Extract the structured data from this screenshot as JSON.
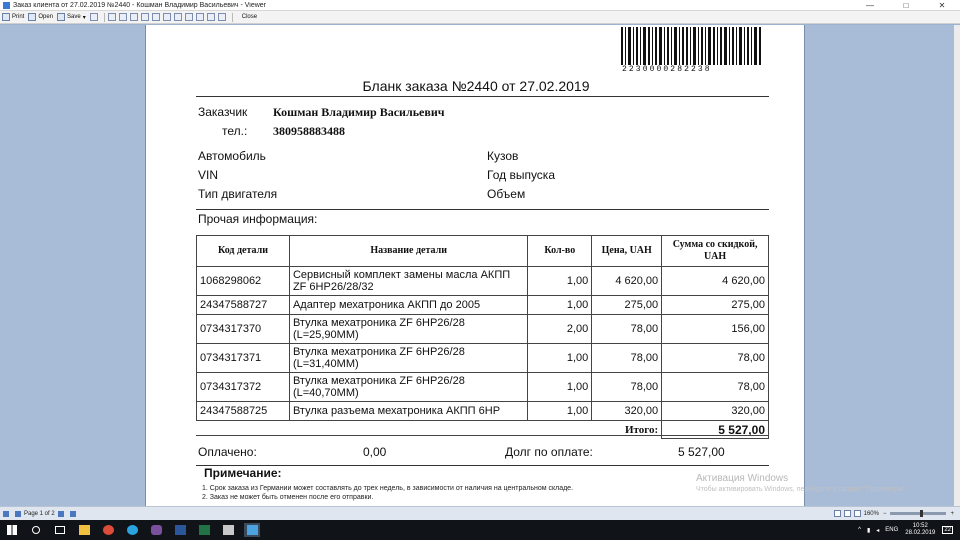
{
  "window": {
    "title": "Заказ клиента от 27.02.2019 №2440 - Кошман Владимир Васильевич - Viewer",
    "minimize": "—",
    "maximize": "□",
    "close": "✕"
  },
  "toolbar": {
    "print": "Print",
    "open": "Open",
    "save": "Save",
    "close": "Close"
  },
  "document": {
    "barcode_number": "2230000282238",
    "title": "Бланк заказа №2440 от 27.02.2019",
    "customer_label": "Заказчик",
    "customer_name": "Кошман Владимир Васильевич",
    "phone_label": "тел.:",
    "phone": "380958883488",
    "car_label": "Автомобиль",
    "vin_label": "VIN",
    "engine_label": "Тип двигателя",
    "body_label": "Кузов",
    "year_label": "Год выпуска",
    "volume_label": "Объем",
    "other_info_label": "Прочая информация:",
    "table": {
      "headers": [
        "Код детали",
        "Название детали",
        "Кол-во",
        "Цена, UAH",
        "Сумма со скидкой, UAH"
      ],
      "rows": [
        {
          "code": "1068298062",
          "name": "Сервисный комплект замены масла АКПП ZF 6HP26/28/32",
          "qty": "1,00",
          "price": "4 620,00",
          "sum": "4 620,00"
        },
        {
          "code": "24347588727",
          "name": "Адаптер мехатроника АКПП до 2005",
          "qty": "1,00",
          "price": "275,00",
          "sum": "275,00"
        },
        {
          "code": "0734317370",
          "name": "Втулка мехатроника ZF 6HP26/28 (L=25,90MM)",
          "qty": "2,00",
          "price": "78,00",
          "sum": "156,00"
        },
        {
          "code": "0734317371",
          "name": "Втулка мехатроника ZF 6HP26/28 (L=31,40MM)",
          "qty": "1,00",
          "price": "78,00",
          "sum": "78,00"
        },
        {
          "code": "0734317372",
          "name": "Втулка мехатроника ZF 6HP26/28 (L=40,70MM)",
          "qty": "1,00",
          "price": "78,00",
          "sum": "78,00"
        },
        {
          "code": "24347588725",
          "name": "Втулка разъема мехатроника АКПП 6HP",
          "qty": "1,00",
          "price": "320,00",
          "sum": "320,00"
        }
      ],
      "total_label": "Итого:",
      "total_value": "5 527,00"
    },
    "paid_label": "Оплачено:",
    "paid_value": "0,00",
    "debt_label": "Долг по оплате:",
    "debt_value": "5 527,00",
    "note_title": "Примечание:",
    "notes": [
      "1. Срок заказа из Германии может составлять до трех недель, в зависимости от наличия на центральном складе.",
      "2. Заказ не может быть отменен после его отправки."
    ]
  },
  "watermark": {
    "line1": "Активация Windows",
    "line2": "Чтобы активировать Windows, перейдите в раздел \"Параметры\"."
  },
  "statusbar": {
    "page": "Page 1 of 2",
    "zoom": "160%"
  },
  "taskbar": {
    "lang": "ENG",
    "time": "10:52",
    "date": "28.02.2019",
    "notifications": "22"
  }
}
